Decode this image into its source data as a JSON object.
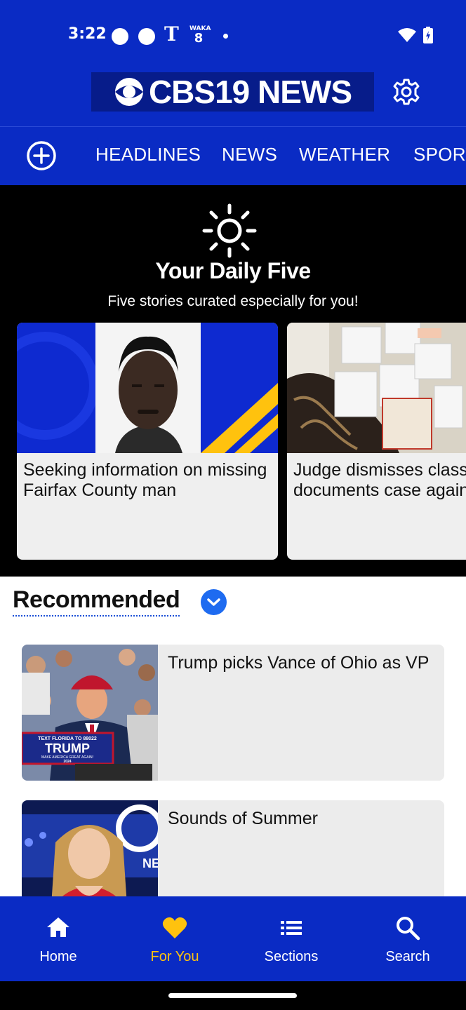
{
  "status_bar": {
    "time": "3:22",
    "t_glyph": "T",
    "waka_label": "WAKA"
  },
  "header": {
    "logo_text": "CBS19 NEWS"
  },
  "nav_tabs": [
    "HEADLINES",
    "NEWS",
    "WEATHER",
    "SPORTS"
  ],
  "daily_five": {
    "title": "Your Daily Five",
    "subtitle": "Five stories curated especially for you!",
    "cards": [
      {
        "headline": "Seeking information on missing Fairfax County man"
      },
      {
        "headline": "Judge dismisses classified documents case against Trump"
      }
    ]
  },
  "recommended": {
    "title": "Recommended",
    "items": [
      {
        "headline": "Trump picks Vance of Ohio as VP",
        "sign_small": "TEXT FLORIDA TO 88022",
        "sign_big": "TRUMP",
        "sign_sub": "MAKE AMERICA GREAT AGAIN!",
        "sign_year": "2024"
      },
      {
        "headline": "Sounds of Summer",
        "screen_text": "NE"
      }
    ]
  },
  "bottom_nav": {
    "items": [
      {
        "label": "Home",
        "icon": "home-icon"
      },
      {
        "label": "For You",
        "icon": "heart-icon",
        "active": true
      },
      {
        "label": "Sections",
        "icon": "list-icon"
      },
      {
        "label": "Search",
        "icon": "search-icon"
      }
    ]
  },
  "colors": {
    "brand_blue": "#0A2BC4",
    "active_yellow": "#FFC20E",
    "chevron_blue": "#1E6BF0"
  }
}
